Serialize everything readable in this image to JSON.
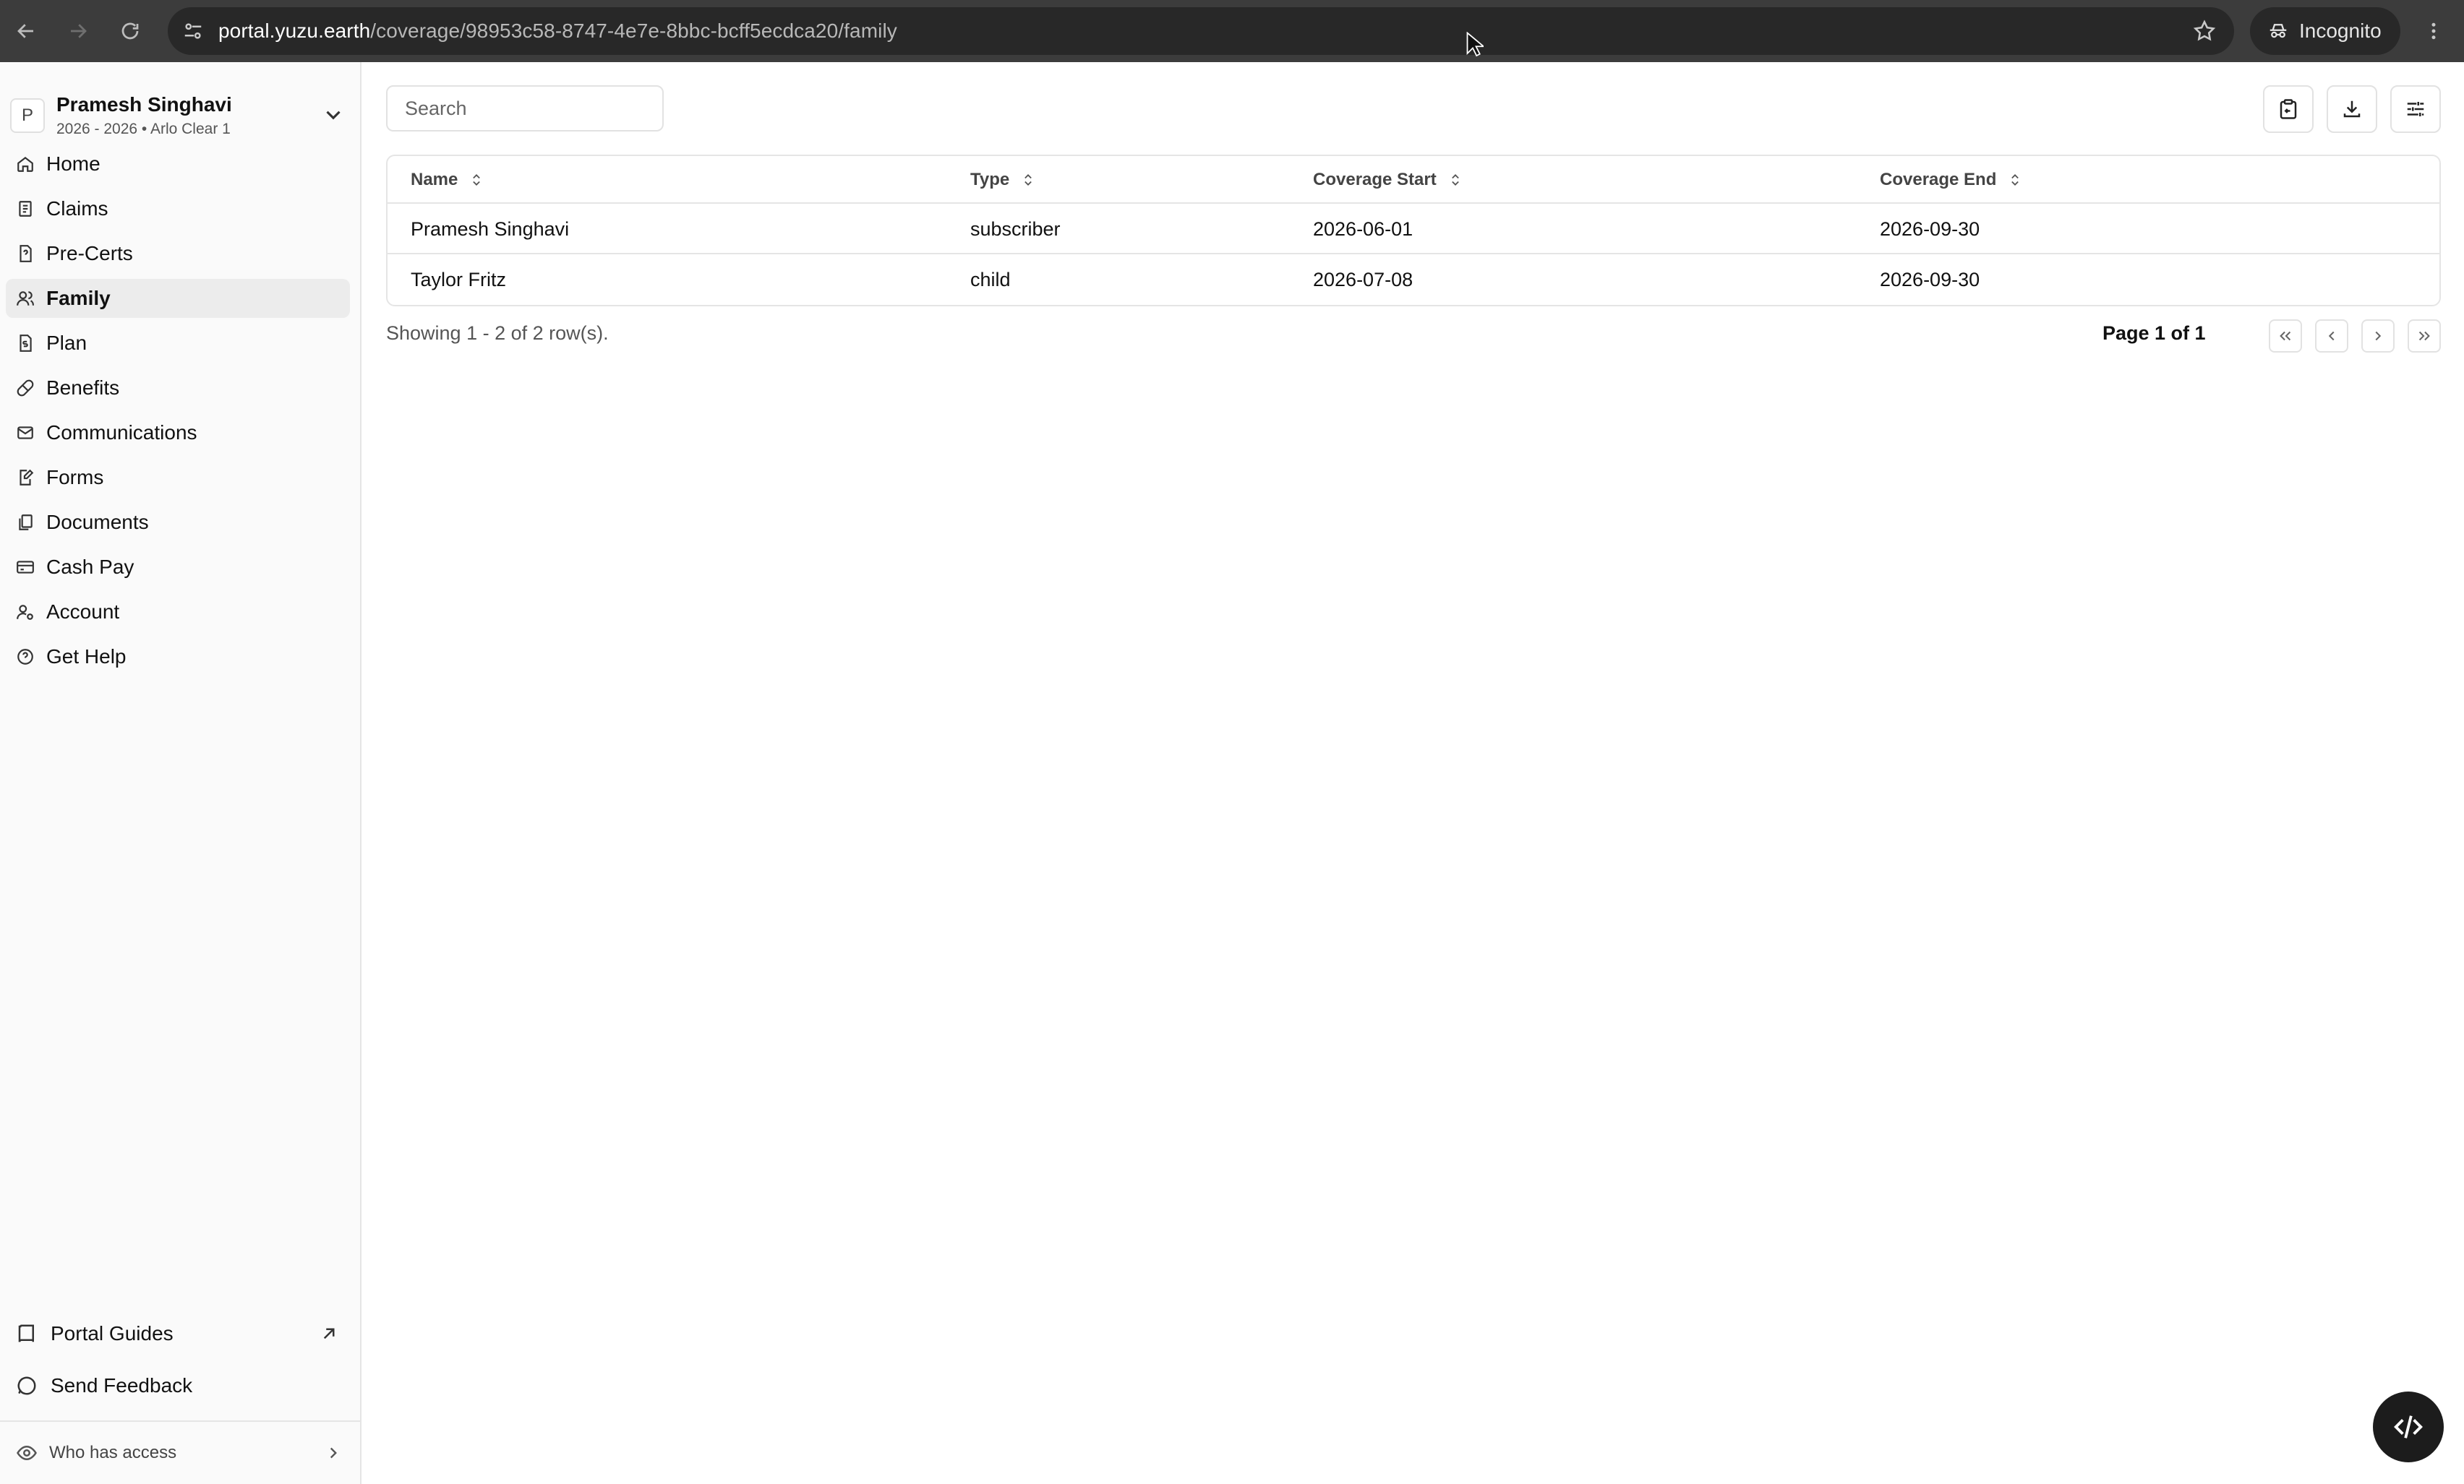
{
  "browser": {
    "url_host": "portal.yuzu.earth",
    "url_path": "/coverage/98953c58-8747-4e7e-8bbc-bcff5ecdca20/family",
    "incognito_label": "Incognito"
  },
  "account": {
    "avatar_letter": "P",
    "name": "Pramesh Singhavi",
    "subtitle": "2026 - 2026 • Arlo Clear 1"
  },
  "sidebar": {
    "items": [
      {
        "label": "Home",
        "icon": "home-icon"
      },
      {
        "label": "Claims",
        "icon": "receipt-icon"
      },
      {
        "label": "Pre-Certs",
        "icon": "file-question-icon"
      },
      {
        "label": "Family",
        "icon": "users-icon",
        "active": true
      },
      {
        "label": "Plan",
        "icon": "file-dollar-icon"
      },
      {
        "label": "Benefits",
        "icon": "pill-icon"
      },
      {
        "label": "Communications",
        "icon": "mail-icon"
      },
      {
        "label": "Forms",
        "icon": "form-pen-icon"
      },
      {
        "label": "Documents",
        "icon": "documents-icon"
      },
      {
        "label": "Cash Pay",
        "icon": "credit-card-icon"
      },
      {
        "label": "Account",
        "icon": "user-cog-icon"
      },
      {
        "label": "Get Help",
        "icon": "help-circle-icon"
      }
    ],
    "footer": {
      "portal_guides": "Portal Guides",
      "send_feedback": "Send Feedback",
      "who_has_access": "Who has access"
    }
  },
  "main": {
    "search_placeholder": "Search",
    "columns": [
      "Name",
      "Type",
      "Coverage Start",
      "Coverage End"
    ],
    "rows": [
      {
        "name": "Pramesh Singhavi",
        "type": "subscriber",
        "start": "2026-06-01",
        "end": "2026-09-30"
      },
      {
        "name": "Taylor Fritz",
        "type": "child",
        "start": "2026-07-08",
        "end": "2026-09-30"
      }
    ],
    "row_count_text": "Showing 1 - 2 of 2 row(s).",
    "page_label": "Page 1 of 1"
  }
}
